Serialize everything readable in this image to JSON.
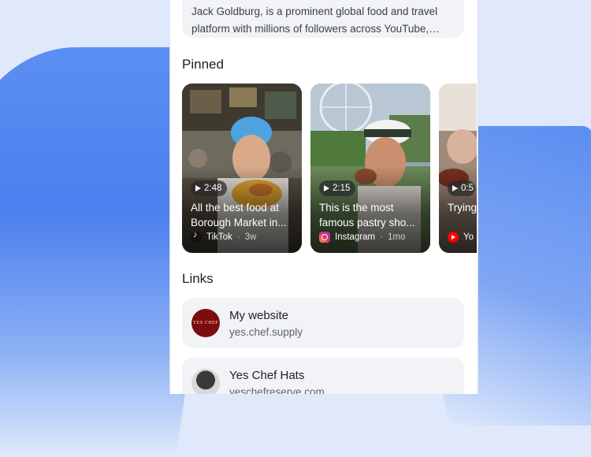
{
  "bio": {
    "text": "Jack Goldburg, is a prominent global food and travel platform with millions of followers across YouTube, Inst..."
  },
  "pinned": {
    "title": "Pinned",
    "videos": [
      {
        "duration": "2:48",
        "title": "All the best food at Borough Market in...",
        "source": "TikTok",
        "age": "3w",
        "icon": "tiktok-icon"
      },
      {
        "duration": "2:15",
        "title": "This is the most famous pastry sho...",
        "source": "Instagram",
        "age": "1mo",
        "icon": "instagram-icon"
      },
      {
        "duration": "0:5",
        "title": "Trying...",
        "source": "Yo",
        "age": "",
        "icon": "youtube-icon"
      }
    ]
  },
  "links": {
    "title": "Links",
    "items": [
      {
        "title": "My website",
        "url": "yes.chef.supply",
        "avatar_text": "YES CHEF"
      },
      {
        "title": "Yes Chef Hats",
        "url": "yeschefreserve.com"
      }
    ]
  },
  "colors": {
    "accent_blue": "#4a7fee",
    "card_bg": "#f1f3f6",
    "text_primary": "#202124",
    "text_secondary": "#5f6368"
  }
}
